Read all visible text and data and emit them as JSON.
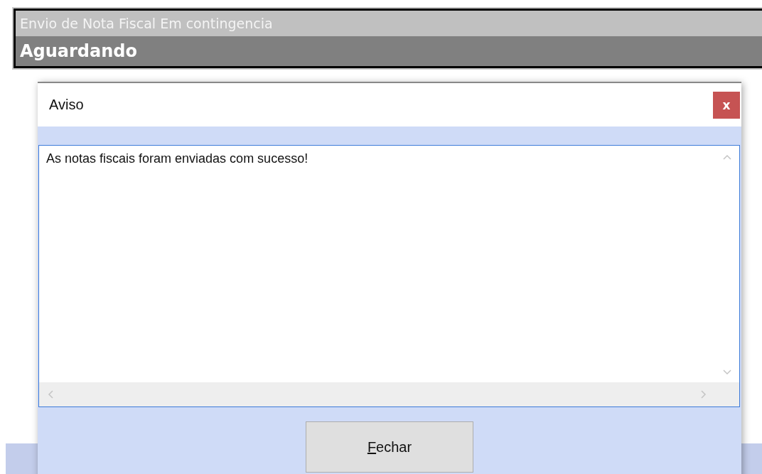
{
  "status_panel": {
    "title": "Envio de Nota Fiscal Em contingencia",
    "status": "Aguardando"
  },
  "dialog": {
    "title": "Aviso",
    "close_label": "x",
    "message": "As notas fiscais foram enviadas com sucesso!",
    "button": {
      "label": "Fechar",
      "mnemonic_underlined": true
    }
  }
}
